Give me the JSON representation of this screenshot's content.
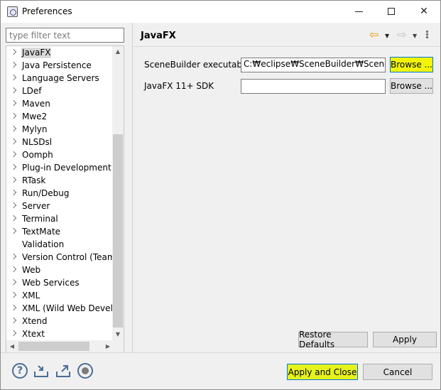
{
  "window": {
    "title": "Preferences"
  },
  "titlebar": {
    "minimize": "—",
    "maximize": "☐",
    "close": "✕"
  },
  "filter": {
    "placeholder": "type filter text",
    "value": ""
  },
  "tree": {
    "items": [
      {
        "label": "JavaFX",
        "selected": true
      },
      {
        "label": "Java Persistence"
      },
      {
        "label": "Language Servers"
      },
      {
        "label": "LDef"
      },
      {
        "label": "Maven"
      },
      {
        "label": "Mwe2"
      },
      {
        "label": "Mylyn"
      },
      {
        "label": "NLSDsl"
      },
      {
        "label": "Oomph"
      },
      {
        "label": "Plug-in Development"
      },
      {
        "label": "RTask"
      },
      {
        "label": "Run/Debug"
      },
      {
        "label": "Server"
      },
      {
        "label": "Terminal"
      },
      {
        "label": "TextMate"
      },
      {
        "label": "Validation",
        "leaf": true
      },
      {
        "label": "Version Control (Team)"
      },
      {
        "label": "Web"
      },
      {
        "label": "Web Services"
      },
      {
        "label": "XML"
      },
      {
        "label": "XML (Wild Web Developer)"
      },
      {
        "label": "Xtend"
      },
      {
        "label": "Xtext"
      }
    ]
  },
  "page": {
    "title": "JavaFX",
    "back_icon": "back-arrow-icon",
    "forward_icon": "forward-arrow-icon",
    "menu_icon": "view-menu-icon",
    "scenebuilder": {
      "label": "SceneBuilder executable",
      "value": "C:₩eclipse₩SceneBuilder₩SceneBuilder.exe",
      "browse": "Browse ..."
    },
    "sdk": {
      "label": "JavaFX 11+ SDK",
      "value": "",
      "browse": "Browse ..."
    },
    "restore_defaults": "Restore Defaults",
    "apply": "Apply"
  },
  "bottom": {
    "help_icon": "help-icon",
    "import_icon": "import-icon",
    "export_icon": "export-icon",
    "oomph_icon": "oomph-record-icon",
    "apply_close": "Apply and Close",
    "cancel": "Cancel"
  },
  "colors": {
    "highlight": "#f2f50a",
    "focus_border": "#0078d7",
    "back_arrow": "#e8a000"
  }
}
